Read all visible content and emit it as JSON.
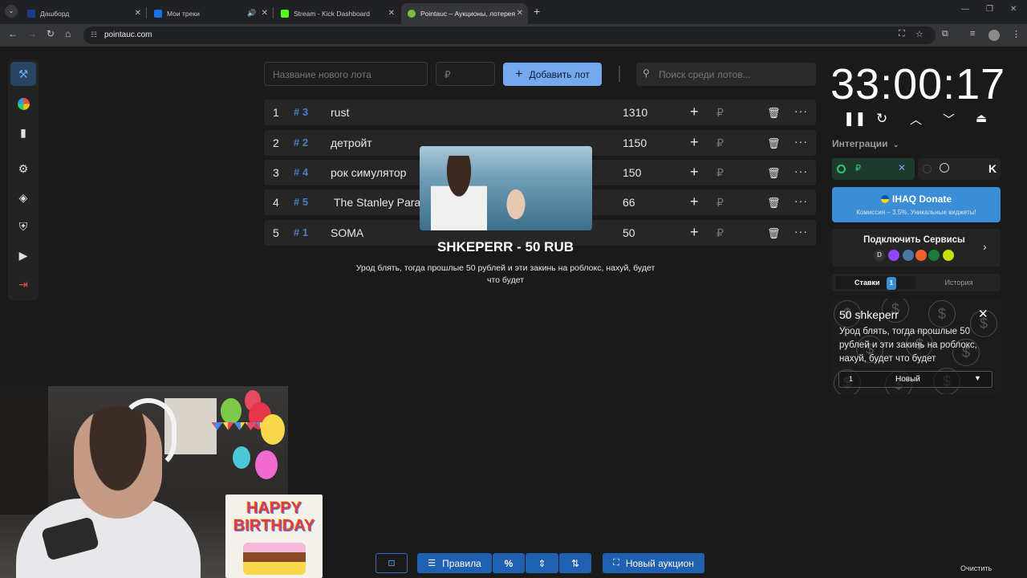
{
  "browser": {
    "tabs": [
      {
        "title": "Дашборд",
        "favicon_color": "#1e3a8a"
      },
      {
        "title": "Мои треки",
        "favicon_color": "#1a73e8"
      },
      {
        "title": "Stream - Kick Dashboard",
        "favicon_color": "#53fc18"
      },
      {
        "title": "Pointauc – Аукционы, лотерея",
        "favicon_color": "#7bc043"
      }
    ],
    "url": "pointauc.com"
  },
  "toolbar": {
    "lot_name_placeholder": "Название нового лота",
    "amount_placeholder": "₽",
    "add_lot_label": "Добавить лот",
    "search_placeholder": "Поиск среди лотов..."
  },
  "lots": [
    {
      "index": "1",
      "hash": "# 3",
      "name": "rust",
      "amount": "1310"
    },
    {
      "index": "2",
      "hash": "# 2",
      "name": "детройт",
      "amount": "1150"
    },
    {
      "index": "3",
      "hash": "# 4",
      "name": "рок симулятор",
      "amount": "150"
    },
    {
      "index": "4",
      "hash": "# 5",
      "name": "The Stanley Para",
      "amount": "66"
    },
    {
      "index": "5",
      "hash": "# 1",
      "name": "SOMA",
      "amount": "50"
    }
  ],
  "row_currency": "₽",
  "donation_alert": {
    "title": "SHKEPERR - 50 RUB",
    "message": "Урод блять, тогда прошлые 50 рублей и эти закинь на роблокс, нахуй, будет что будет"
  },
  "timer": "33:00:17",
  "integrations": {
    "label": "Интеграции",
    "currency": "₽"
  },
  "donate_banner": {
    "title": "IHAQ Donate",
    "subtitle": "Комиссия – 3,5%. Уникальные виджеты!"
  },
  "connect_services": {
    "label": "Подключить Сервисы",
    "icon_da": "D"
  },
  "bets": {
    "tab_bets": "Ставки",
    "tab_bets_count": "1",
    "tab_history": "История",
    "card_title": "50 shkeperr",
    "card_message": "Урод блять, тогда прошлые 50 рублей и эти закинь на роблокс, нахуй, будет что будет",
    "card_number": "1",
    "card_status": "Новый"
  },
  "bottom": {
    "rules_label": "Правила",
    "new_auction_label": "Новый аукцион",
    "clear_label": "Очистить"
  },
  "overlay": {
    "birthday_text": "HAPPY BIRTHDAY"
  }
}
